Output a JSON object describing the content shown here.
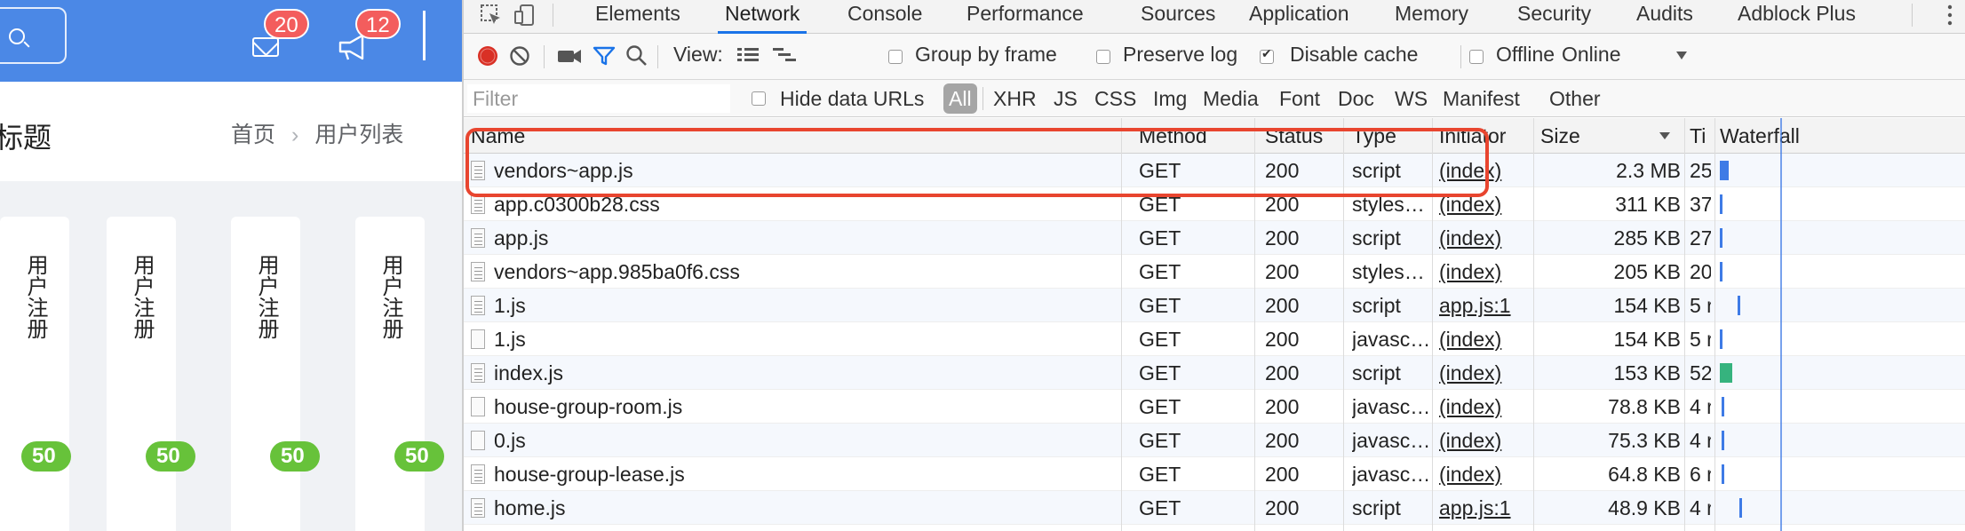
{
  "app": {
    "header": {
      "mail_badge": "20",
      "bell_badge": "12"
    },
    "page_title": "标题",
    "breadcrumb": {
      "home": "首页",
      "separator": "›",
      "current": "用户列表"
    },
    "cards": [
      {
        "label": "用户注册",
        "badge": "50"
      },
      {
        "label": "用户注册",
        "badge": "50"
      },
      {
        "label": "用户注册",
        "badge": "50"
      },
      {
        "label": "用户注册",
        "badge": "50"
      }
    ]
  },
  "devtools": {
    "tabs": [
      "Elements",
      "Network",
      "Console",
      "Performance",
      "Sources",
      "Application",
      "Memory",
      "Security",
      "Audits",
      "Adblock Plus"
    ],
    "active_tab": "Network",
    "toolbar": {
      "view_label": "View:",
      "group_by_frame": {
        "label": "Group by frame",
        "checked": false
      },
      "preserve_log": {
        "label": "Preserve log",
        "checked": false
      },
      "disable_cache": {
        "label": "Disable cache",
        "checked": true
      },
      "offline": {
        "label": "Offline",
        "checked": false
      },
      "throttling": "Online"
    },
    "filter": {
      "placeholder": "Filter",
      "hide_data_urls": "Hide data URLs",
      "types": [
        "All",
        "XHR",
        "JS",
        "CSS",
        "Img",
        "Media",
        "Font",
        "Doc",
        "WS",
        "Manifest",
        "Other"
      ],
      "active_type": "All"
    },
    "columns": {
      "name": "Name",
      "method": "Method",
      "status": "Status",
      "type": "Type",
      "initiator": "Initiator",
      "size": "Size",
      "time": "Ti",
      "waterfall": "Waterfall"
    },
    "requests": [
      {
        "name": "vendors~app.js",
        "method": "GET",
        "status": "200",
        "type": "script",
        "initiator": "(index)",
        "size": "2.3 MB",
        "time": "25"
      },
      {
        "name": "app.c0300b28.css",
        "method": "GET",
        "status": "200",
        "type": "styles…",
        "initiator": "(index)",
        "size": "311 KB",
        "time": "37"
      },
      {
        "name": "app.js",
        "method": "GET",
        "status": "200",
        "type": "script",
        "initiator": "(index)",
        "size": "285 KB",
        "time": "27"
      },
      {
        "name": "vendors~app.985ba0f6.css",
        "method": "GET",
        "status": "200",
        "type": "styles…",
        "initiator": "(index)",
        "size": "205 KB",
        "time": "20"
      },
      {
        "name": "1.js",
        "method": "GET",
        "status": "200",
        "type": "script",
        "initiator": "app.js:1",
        "size": "154 KB",
        "time": "5 r"
      },
      {
        "name": "1.js",
        "method": "GET",
        "status": "200",
        "type": "javasc…",
        "initiator": "(index)",
        "size": "154 KB",
        "time": "5 r"
      },
      {
        "name": "index.js",
        "method": "GET",
        "status": "200",
        "type": "script",
        "initiator": "(index)",
        "size": "153 KB",
        "time": "52"
      },
      {
        "name": "house-group-room.js",
        "method": "GET",
        "status": "200",
        "type": "javasc…",
        "initiator": "(index)",
        "size": "78.8 KB",
        "time": "4 r"
      },
      {
        "name": "0.js",
        "method": "GET",
        "status": "200",
        "type": "javasc…",
        "initiator": "(index)",
        "size": "75.3 KB",
        "time": "4 r"
      },
      {
        "name": "house-group-lease.js",
        "method": "GET",
        "status": "200",
        "type": "javasc…",
        "initiator": "(index)",
        "size": "64.8 KB",
        "time": "6 r"
      },
      {
        "name": "home.js",
        "method": "GET",
        "status": "200",
        "type": "script",
        "initiator": "app.js:1",
        "size": "48.9 KB",
        "time": "4 r"
      }
    ],
    "colors": {
      "accent": "#1a73e8",
      "record": "#d93025",
      "highlight": "#e8452f",
      "waterfall": "#3e7be6"
    }
  }
}
